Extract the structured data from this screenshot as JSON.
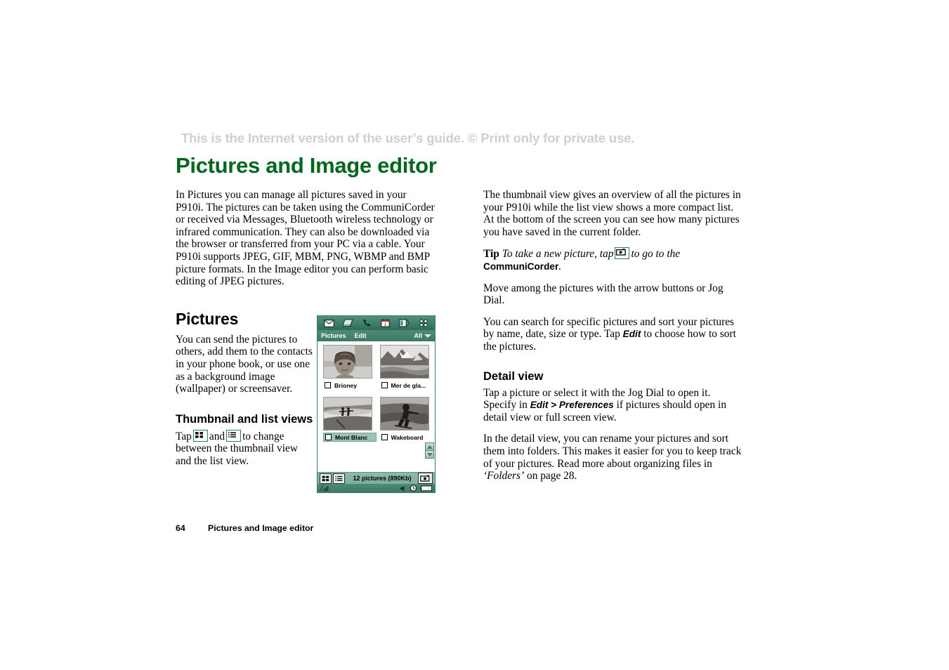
{
  "notice": "This is the Internet version of the user’s guide. © Print only for private use.",
  "title": "Pictures and Image editor",
  "footer": {
    "page_number": "64",
    "label": "Pictures and Image editor"
  },
  "left_column": {
    "intro": "In Pictures you can manage all pictures saved in your P910i. The pictures can be taken using the CommuniCorder or received via Messages, Bluetooth wireless technology or infrared communication. They can also be downloaded via the browser or transferred from your PC via a cable. Your P910i supports JPEG, GIF, MBM, PNG, WBMP and BMP picture formats. In the Image editor you can perform basic editing of JPEG pictures.",
    "pictures_heading": "Pictures",
    "pictures_body": "You can send the pictures to others, add them to the contacts in your phone book, or use one as a background image (wallpaper) or screensaver.",
    "thumbnail_heading": "Thumbnail and list views",
    "thumbnail_body_1": "Tap",
    "thumbnail_body_2": "and",
    "thumbnail_body_3": "to change between the thumbnail view and the list view."
  },
  "right_column": {
    "para_1": "The thumbnail view gives an overview of all the pictures in your P910i while the list view shows a more compact list. At the bottom of the screen you can see how many pictures you have saved in the current folder.",
    "tip_label": "Tip",
    "tip_text_1": "To take a new picture, tap",
    "tip_text_2": "to go to the",
    "tip_emphasis": "CommuniCorder",
    "tip_end": ".",
    "para_2": "Move among the pictures with the arrow buttons or Jog Dial.",
    "para_3_1": "You can search for specific pictures and sort your pictures by name, date, size or type. Tap",
    "para_3_emphasis": "Edit",
    "para_3_2": "to choose how to sort the pictures.",
    "detail_heading": "Detail view",
    "detail_para_1_1": "Tap a picture or select it with the Jog Dial to open it. Specify in",
    "detail_para_1_emphasis": "Edit > Preferences",
    "detail_para_1_2": "if pictures should open in detail view or full screen view.",
    "detail_para_2_1": "In the detail view, you can rename your pictures and sort them into folders. This makes it easier for you to keep track of your pictures. Read more about organizing files in",
    "detail_para_2_emphasis": "‘Folders’",
    "detail_para_2_2": "on page 28."
  },
  "device": {
    "toolbar_icons": [
      "envelope-icon",
      "jotter-icon",
      "phone-handset-icon",
      "calendar-icon",
      "contacts-icon",
      "more-apps-grid-icon"
    ],
    "menubar": {
      "app_name": "Pictures",
      "edit_menu": "Edit",
      "filter": "All"
    },
    "thumbnails": [
      {
        "name": "Brioney",
        "selected": false,
        "art": "portrait-girl"
      },
      {
        "name": "Mer de gla...",
        "selected": false,
        "art": "mountain-glacier"
      },
      {
        "name": "Mont Blanc",
        "selected": true,
        "art": "beach-surfers"
      },
      {
        "name": "Wakeboard",
        "selected": false,
        "art": "wakeboarder"
      }
    ],
    "status": {
      "thumbnail_view_icon": "grid-view-icon",
      "list_view_icon": "list-view-icon",
      "count_text": "12 pictures (890Kb)",
      "camera_icon": "camera-icon"
    },
    "tray": {
      "signal_icon": "signal-bars-icon",
      "speaker_icon": "speaker-icon",
      "clock_icon": "clock-icon",
      "battery_icon": "battery-icon"
    },
    "scroll": {
      "up_icon": "scroll-up-icon",
      "down_icon": "scroll-down-icon"
    }
  },
  "colors": {
    "title_green": "#00671f",
    "device_teal": "#3f7e6a",
    "selection_teal": "#9dc3b5",
    "notice_grey": "#cfcfcf"
  }
}
